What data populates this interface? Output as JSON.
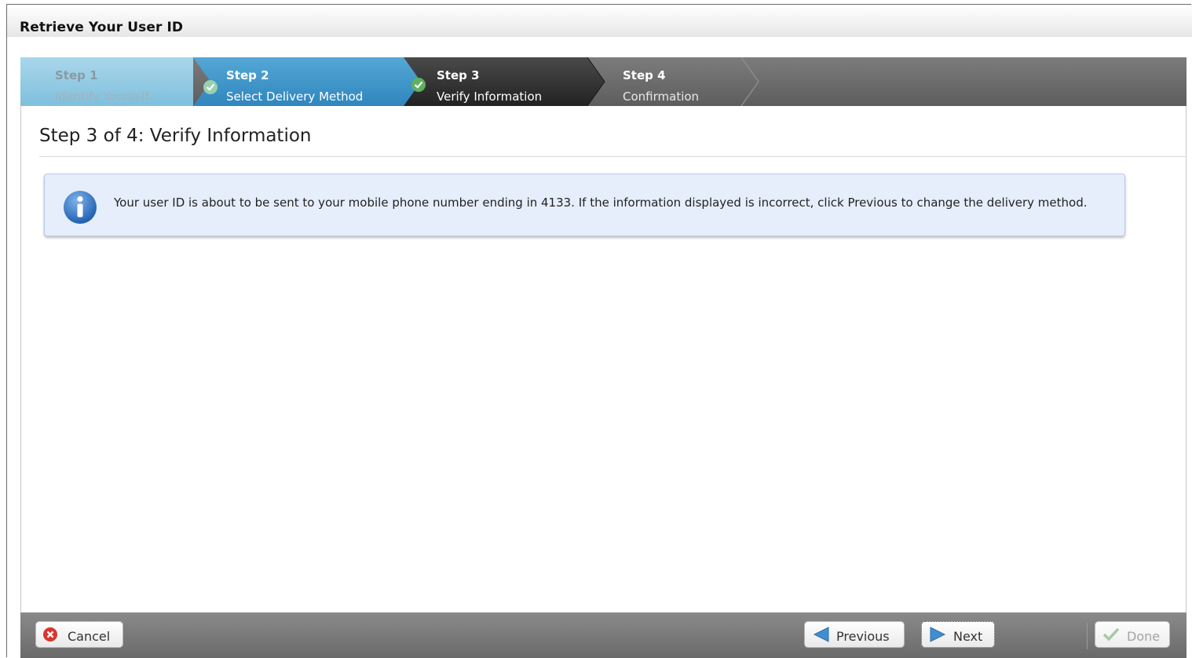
{
  "window": {
    "title": "Retrieve Your User ID"
  },
  "wizard": {
    "steps": [
      {
        "number": "Step 1",
        "name": "Identify Yourself",
        "state": "completed"
      },
      {
        "number": "Step 2",
        "name": "Select Delivery Method",
        "state": "completed"
      },
      {
        "number": "Step 3",
        "name": "Verify Information",
        "state": "current"
      },
      {
        "number": "Step 4",
        "name": "Confirmation",
        "state": "upcoming"
      }
    ]
  },
  "main": {
    "heading": "Step 3 of 4: Verify Information",
    "info_message": "Your user ID is about to be sent to your mobile phone number ending in 4133. If the information displayed is incorrect, click Previous to change the delivery method.",
    "info_icon": "info-icon"
  },
  "footer": {
    "cancel_label": "Cancel",
    "previous_label": "Previous",
    "next_label": "Next",
    "done_label": "Done"
  },
  "colors": {
    "step_completed": "#8ec9e3",
    "step_active_blue": "#3a8fc2",
    "step_current": "#333333",
    "info_background": "#e6eefb"
  }
}
